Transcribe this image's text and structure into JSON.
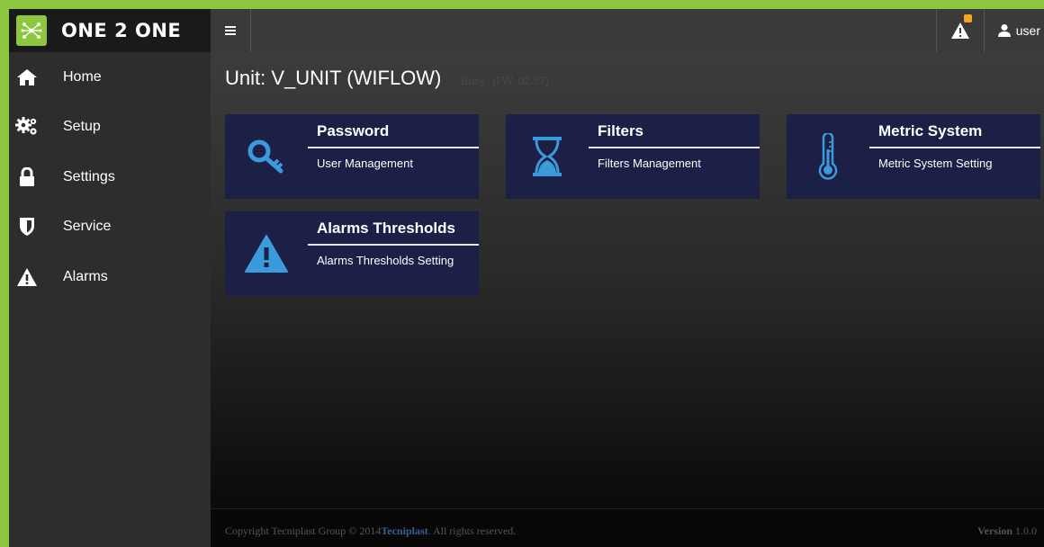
{
  "brand": {
    "title": "ONE 2 ONE"
  },
  "topbar": {
    "user_label": "user"
  },
  "sidebar": {
    "items": [
      {
        "label": "Home",
        "icon": "home-icon"
      },
      {
        "label": "Setup",
        "icon": "gears-icon"
      },
      {
        "label": "Settings",
        "icon": "lock-icon"
      },
      {
        "label": "Service",
        "icon": "shield-icon"
      },
      {
        "label": "Alarms",
        "icon": "warning-icon"
      }
    ]
  },
  "main": {
    "unit_title": "Unit: V_UNIT (WIFLOW)",
    "unit_status": "Busy",
    "unit_fw": "(FW. 02.57)",
    "tiles": [
      {
        "title": "Password",
        "subtitle": "User Management",
        "icon": "key-icon"
      },
      {
        "title": "Filters",
        "subtitle": "Filters Management",
        "icon": "hourglass-icon"
      },
      {
        "title": "Metric System",
        "subtitle": "Metric System Setting",
        "icon": "thermometer-icon"
      },
      {
        "title": "Alarms Thresholds",
        "subtitle": "Alarms Thresholds Setting",
        "icon": "warning-icon"
      }
    ]
  },
  "footer": {
    "copyright_prefix": "Copyright Tecniplast Group © 2014",
    "copyright_brand": "Tecniplast",
    "copyright_suffix": ". All rights reserved.",
    "version_label": "Version",
    "version_number": "1.0.0"
  },
  "colors": {
    "accent_green": "#8dc63f",
    "tile_bg": "#1c2046",
    "icon_blue": "#3b9ad9",
    "alert_badge": "#f5a623"
  }
}
